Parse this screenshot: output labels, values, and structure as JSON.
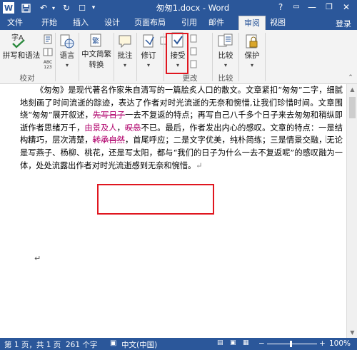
{
  "window": {
    "title": "匆匆1.docx - Word",
    "help_label": "?",
    "minimize_label": "—",
    "restore_label": "❐",
    "close_label": "✕"
  },
  "quick_access": [
    {
      "name": "word-logo-icon",
      "glyph": "W"
    },
    {
      "name": "save-icon",
      "glyph": "💾"
    },
    {
      "name": "undo-icon",
      "glyph": "↶"
    },
    {
      "name": "redo-icon",
      "glyph": "↻"
    },
    {
      "name": "touch-mode-icon",
      "glyph": "☐"
    },
    {
      "name": "customize-qa-icon",
      "glyph": "▾"
    }
  ],
  "tabs": [
    {
      "label": "文件",
      "active": false
    },
    {
      "label": "开始",
      "active": false
    },
    {
      "label": "插入",
      "active": false
    },
    {
      "label": "设计",
      "active": false
    },
    {
      "label": "页面布局",
      "active": false
    },
    {
      "label": "引用",
      "active": false
    },
    {
      "label": "邮件",
      "active": false
    },
    {
      "label": "审阅",
      "active": true
    },
    {
      "label": "视图",
      "active": false
    }
  ],
  "login_label": "登录",
  "ribbon": {
    "spelling_label": "拼写和语法",
    "proofing_group": "校对",
    "language_label": "语言",
    "chinese_convert_label": "中文简繁转换",
    "comment_label": "批注",
    "revise_label": "修订",
    "accept_label": "接受",
    "changes_group": "更改",
    "compare_label": "比较",
    "compare_group": "比较",
    "protect_label": "保护",
    "dropdown_glyph": "▾"
  },
  "document": {
    "p1": "《匆匆》是现代著名作家朱自清写的一篇脍炙人口的散文。文章紧扣“匆匆”二字，细腻地刻画了时间流逝的踪迹，表达了作者对时光流逝的无奈和惋惜,让我们珍惜时间。文章围绕“匆匆”展开叙述，",
    "del1": "先写日子",
    "p2": "一去不复返的特点；再写自己八千多个日子来去匆匆和稍纵即逝作者思绪万千，",
    "ins1": "由景及人",
    "p3": "，",
    "del2": "叹息",
    "p4": "不已。最后，作者发出内心的感叹。文章的特点：一是结构精巧，层次清楚，",
    "ins2": "转承自然",
    "p5": "，首尾呼应；二是文字优美，纯朴简练；三是情景交融，无论是写燕子、杨柳、桃花，还是写太阳，都与“我们的日子为什么一去不复返呢”的感叹融为一体，处处流露出作者对时光流逝感到无奈和惋惜。",
    "para_mark": "↵",
    "caret_mark": "↵"
  },
  "status": {
    "page": "第 1 页，共 1 页",
    "words": "261 个字",
    "lang_icon": "▣",
    "lang": "中文(中国)",
    "zoom_minus": "−",
    "zoom_plus": "+",
    "zoom": "100%"
  },
  "colors": {
    "accent": "#2b579a",
    "highlight": "#e0161f",
    "revision": "#b0006b"
  }
}
